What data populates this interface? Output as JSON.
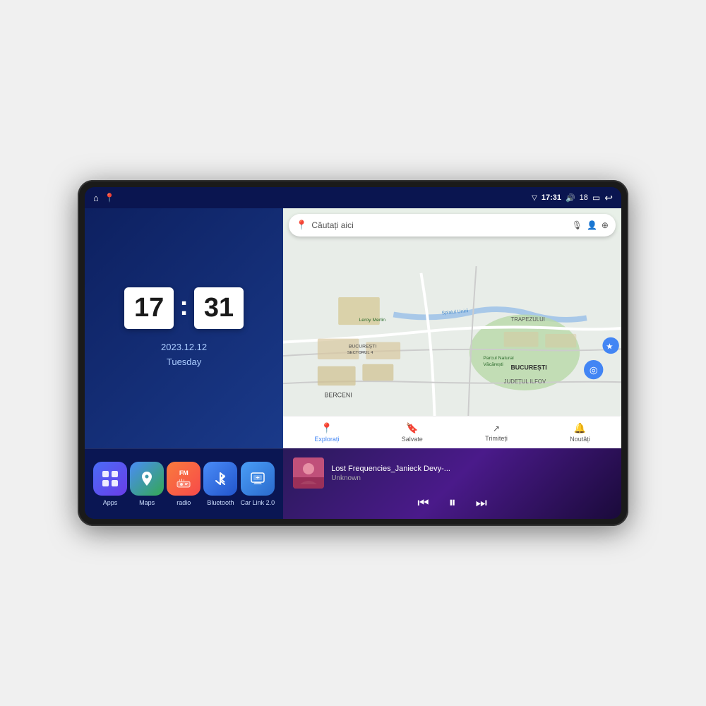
{
  "device": {
    "screen_bg": "#0a1a4a"
  },
  "status_bar": {
    "left_icons": [
      "home",
      "maps"
    ],
    "time": "17:31",
    "signal_icon": "▾",
    "volume_icon": "🔊",
    "volume_level": "18",
    "battery_icon": "🔋",
    "back_icon": "↩"
  },
  "clock": {
    "hour": "17",
    "minute": "31",
    "date": "2023.12.12",
    "day": "Tuesday"
  },
  "apps": [
    {
      "id": "apps",
      "label": "Apps",
      "icon": "⊞",
      "class": "apps-icon"
    },
    {
      "id": "maps",
      "label": "Maps",
      "icon": "📍",
      "class": "maps-icon"
    },
    {
      "id": "radio",
      "label": "radio",
      "icon": "📻",
      "class": "radio-icon"
    },
    {
      "id": "bluetooth",
      "label": "Bluetooth",
      "icon": "⚡",
      "class": "bluetooth-icon"
    },
    {
      "id": "carlink",
      "label": "Car Link 2.0",
      "icon": "📱",
      "class": "carlink-icon"
    }
  ],
  "map": {
    "search_placeholder": "Căutați aici",
    "nav_items": [
      {
        "id": "explore",
        "label": "Explorați",
        "icon": "📍",
        "active": true
      },
      {
        "id": "saved",
        "label": "Salvate",
        "icon": "🔖",
        "active": false
      },
      {
        "id": "share",
        "label": "Trimiteți",
        "icon": "🔄",
        "active": false
      },
      {
        "id": "news",
        "label": "Noutăți",
        "icon": "🔔",
        "active": false
      }
    ],
    "location_labels": [
      "TRAPEZULUI",
      "BUCUREȘTI",
      "JUDEȚUL ILFOV",
      "BERCENI",
      "Parcul Natural Văcărești",
      "Leroy Merlin",
      "BUCUREȘTI SECTORUL 4"
    ]
  },
  "music": {
    "title": "Lost Frequencies_Janieck Devy-...",
    "artist": "Unknown",
    "controls": {
      "prev": "⏮",
      "play": "⏸",
      "next": "⏭"
    }
  }
}
